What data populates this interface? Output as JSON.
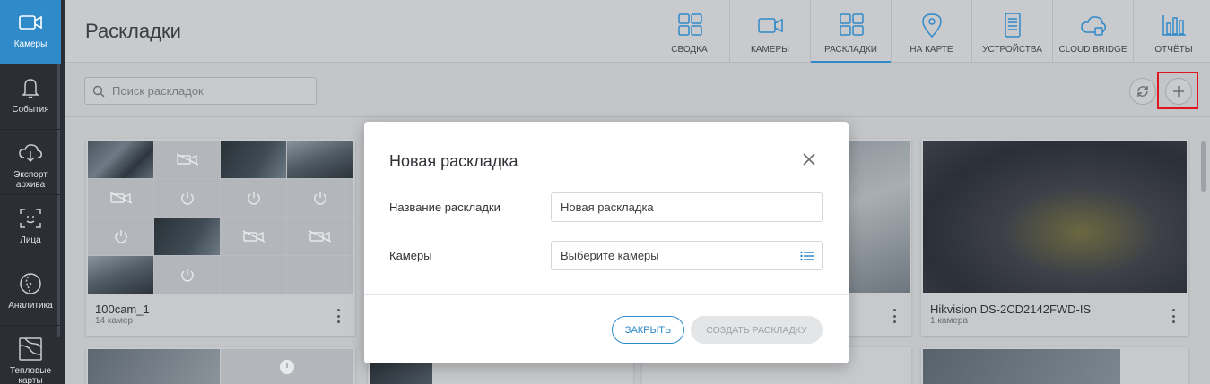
{
  "sidebar": {
    "items": [
      {
        "label": "Камеры",
        "icon": "camera-icon",
        "active": true
      },
      {
        "label": "События",
        "icon": "bell-icon",
        "active": false
      },
      {
        "label": "Экспорт архива",
        "icon": "cloud-download-icon",
        "active": false
      },
      {
        "label": "Лица",
        "icon": "face-scan-icon",
        "active": false
      },
      {
        "label": "Аналитика",
        "icon": "analytics-icon",
        "active": false
      },
      {
        "label": "Тепловые карты",
        "icon": "heatmap-icon",
        "active": false
      }
    ]
  },
  "header": {
    "title": "Раскладки",
    "tabs": [
      {
        "label": "СВОДКА",
        "icon": "grid-icon"
      },
      {
        "label": "КАМЕРЫ",
        "icon": "video-camera-icon"
      },
      {
        "label": "РАСКЛАДКИ",
        "icon": "layouts-icon",
        "active": true
      },
      {
        "label": "НА КАРТЕ",
        "icon": "map-pin-icon"
      },
      {
        "label": "УСТРОЙСТВА",
        "icon": "server-icon"
      },
      {
        "label": "CLOUD BRIDGE",
        "icon": "cloud-bridge-icon"
      },
      {
        "label": "ОТЧЁТЫ",
        "icon": "bar-chart-icon"
      }
    ]
  },
  "toolbar": {
    "search_placeholder": "Поиск раскладок"
  },
  "cards": [
    {
      "name": "100cam_1",
      "subtitle": "14 камер"
    },
    {
      "name": "Hikvision DS-2CD2142FWD-IS",
      "subtitle": "1 камера"
    }
  ],
  "dialog": {
    "title": "Новая раскладка",
    "name_label": "Название раскладки",
    "name_value": "Новая раскладка",
    "cameras_label": "Камеры",
    "cameras_placeholder": "Выберите камеры",
    "close_button": "ЗАКРЫТЬ",
    "create_button": "СОЗДАТЬ РАСКЛАДКУ"
  },
  "colors": {
    "accent": "#2f8ac9",
    "highlight": "#e0141c",
    "sidebar_bg": "#2b2f35"
  }
}
